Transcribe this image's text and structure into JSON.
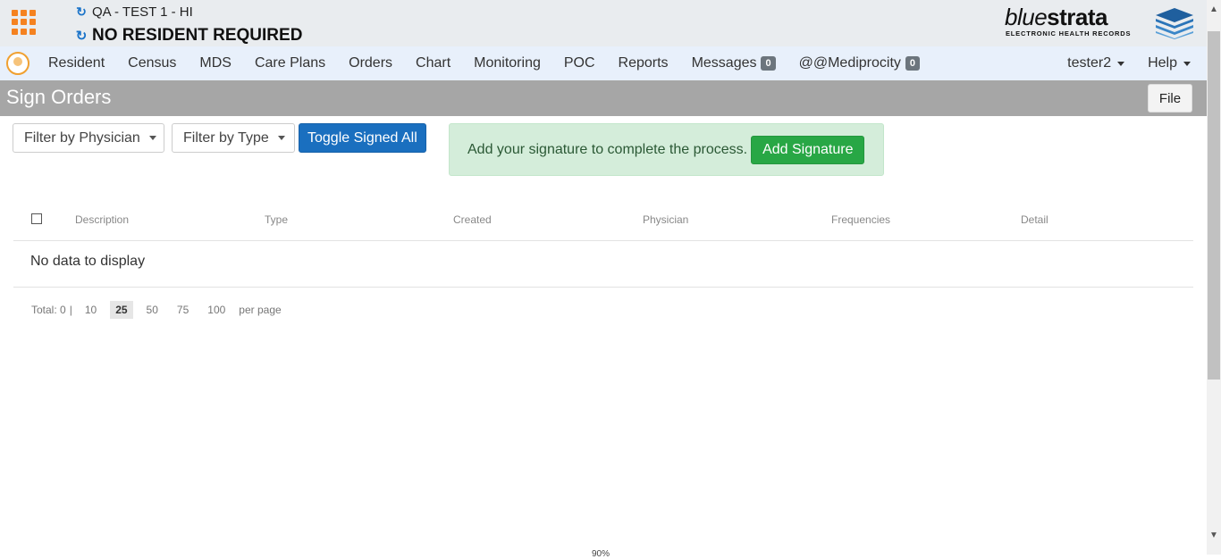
{
  "header": {
    "facility": "QA - TEST 1 - HI",
    "resident": "NO RESIDENT REQUIRED"
  },
  "logo": {
    "word_thin": "blue",
    "word_bold": "strata",
    "subtitle": "ELECTRONIC HEALTH RECORDS"
  },
  "nav": {
    "items": [
      "Resident",
      "Census",
      "MDS",
      "Care Plans",
      "Orders",
      "Chart",
      "Monitoring",
      "POC",
      "Reports"
    ],
    "messages": {
      "label": "Messages",
      "count": "0"
    },
    "mediprocity": {
      "label": "@@Mediprocity",
      "count": "0"
    },
    "user": "tester2",
    "help": "Help"
  },
  "page": {
    "title": "Sign Orders",
    "file_button": "File"
  },
  "toolbar": {
    "filter_physician": "Filter by Physician",
    "filter_type": "Filter by Type",
    "toggle_signed": "Toggle Signed All"
  },
  "alert": {
    "text": "Add your signature to complete the process.",
    "button": "Add Signature"
  },
  "grid": {
    "columns": [
      "Description",
      "Type",
      "Created",
      "Physician",
      "Frequencies",
      "Detail"
    ],
    "empty_text": "No data to display"
  },
  "pager": {
    "total": "Total: 0",
    "separator": "|",
    "sizes": [
      "10",
      "25",
      "50",
      "75",
      "100"
    ],
    "selected": "25",
    "per_page": "per page"
  },
  "footer": {
    "zoom": "90%"
  },
  "colors": {
    "accent_orange": "#f58220",
    "primary_blue": "#1a6fbf",
    "success_green": "#28a745",
    "titlebar_gray": "#a6a6a6",
    "navbar_bg": "#e8f0fb"
  },
  "icons": {
    "app_menu": "grid-9-icon",
    "refresh": "refresh-icon",
    "brand": "layers-icon"
  }
}
